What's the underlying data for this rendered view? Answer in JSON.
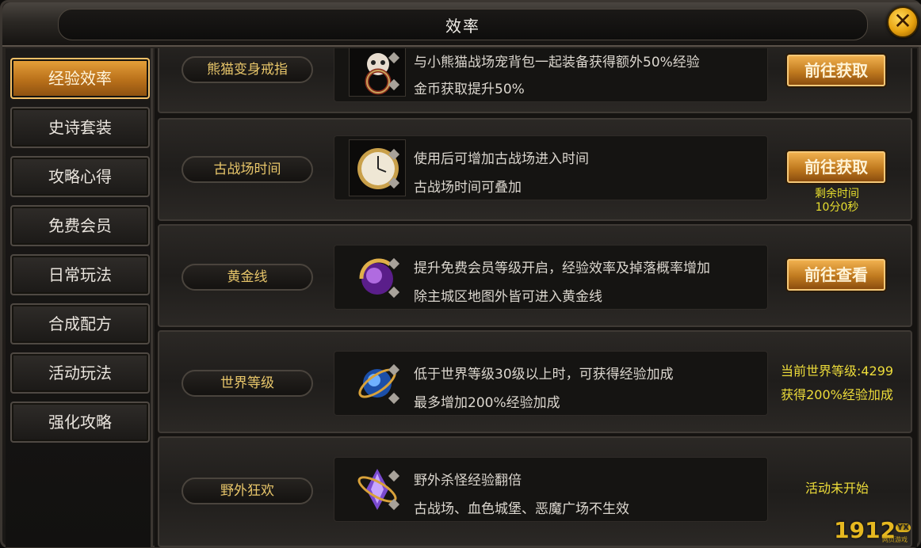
{
  "window": {
    "title": "效率"
  },
  "sidebar": {
    "items": [
      {
        "label": "经验效率",
        "active": true
      },
      {
        "label": "史诗套装"
      },
      {
        "label": "攻略心得"
      },
      {
        "label": "免费会员"
      },
      {
        "label": "日常玩法"
      },
      {
        "label": "合成配方"
      },
      {
        "label": "活动玩法"
      },
      {
        "label": "强化攻略"
      }
    ]
  },
  "rows": [
    {
      "label": "熊猫变身戒指",
      "icon": "panda-ring-icon",
      "lines": [
        "与小熊猫战场宠背包一起装备获得额外50%经验",
        "金币获取提升50%"
      ],
      "button": "前往获取"
    },
    {
      "label": "古战场时间",
      "icon": "pocket-watch-icon",
      "lines": [
        "使用后可增加古战场进入时间",
        "古战场时间可叠加"
      ],
      "button": "前往获取",
      "remaining_label": "剩余时间",
      "remaining_value": "10分0秒"
    },
    {
      "label": "黄金线",
      "icon": "purple-orb-icon",
      "lines": [
        "提升免费会员等级开启，经验效率及掉落概率增加",
        "除主城区地图外皆可进入黄金线"
      ],
      "button": "前往查看"
    },
    {
      "label": "世界等级",
      "icon": "blue-orb-icon",
      "lines": [
        "低于世界等级30级以上时，可获得经验加成",
        "最多增加200%经验加成"
      ],
      "status_line1": "当前世界等级:4299",
      "status_line2": "获得200%经验加成"
    },
    {
      "label": "野外狂欢",
      "icon": "purple-crystal-icon",
      "lines": [
        "野外杀怪经验翻倍",
        "古战场、血色城堡、恶魔广场不生效"
      ],
      "status_line1": "活动未开始"
    }
  ],
  "watermark": {
    "brand": "1912",
    "tag": "YX",
    "sub": "网页游戏"
  },
  "colors": {
    "accent_gold": "#e8c66a",
    "status_yellow": "#eedd3a",
    "button_orange": "#c07a1f"
  }
}
